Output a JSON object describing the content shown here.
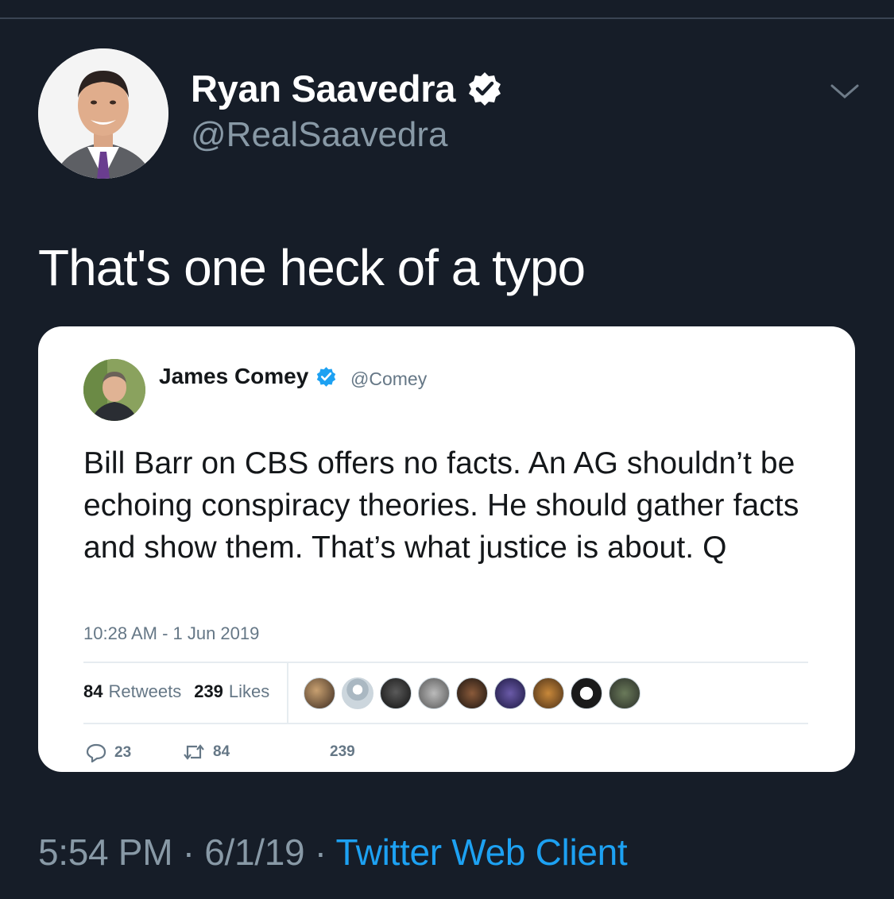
{
  "tweet": {
    "author_name": "Ryan Saavedra",
    "author_handle": "@RealSaavedra",
    "text": "That's one heck of a typo",
    "timestamp": "5:54 PM · 6/1/19 · ",
    "client": "Twitter Web Client"
  },
  "embedded": {
    "author_name": "James Comey",
    "author_handle": "@Comey",
    "text": "Bill Barr on CBS offers no facts. An AG shouldn’t be echoing conspiracy theories. He should gather facts and show them. That’s what justice is about. Q",
    "timestamp": "10:28 AM - 1 Jun 2019",
    "retweets_count": "84",
    "retweets_label": "Retweets",
    "likes_count": "239",
    "likes_label": "Likes",
    "actions": {
      "replies": "23",
      "retweets": "84",
      "likes": "239"
    }
  },
  "icons": {
    "verified": "verified-badge-icon",
    "menu": "chevron-down-icon",
    "reply": "reply-icon",
    "retweet": "retweet-icon"
  },
  "colors": {
    "background": "#161d28",
    "link": "#1da1f2",
    "muted": "#8899a6",
    "verified": "#1da1f2"
  }
}
